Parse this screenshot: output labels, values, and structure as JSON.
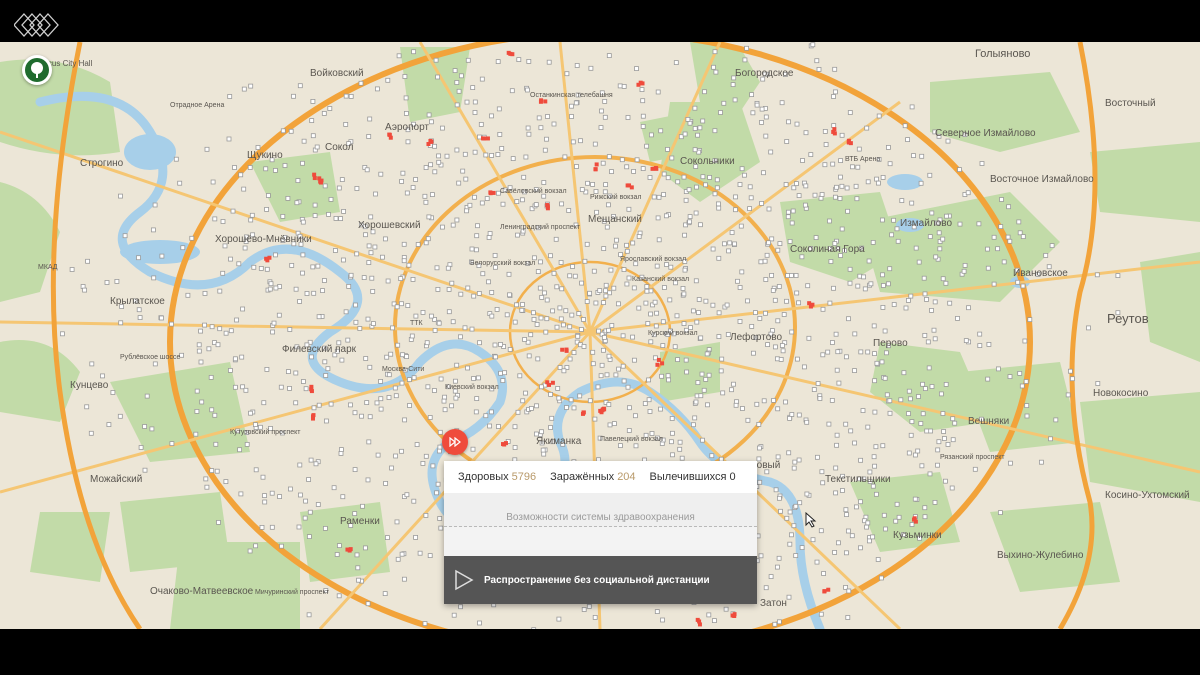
{
  "panel": {
    "stats": [
      {
        "label": "Здоровых",
        "value": "5796"
      },
      {
        "label": "Заражённых",
        "value": "204"
      },
      {
        "label": "Вылечившихся",
        "value": "0"
      }
    ],
    "health_system_label": "Возможности системы здравоохранения",
    "run_label": "Распространение без социальной дистанции"
  },
  "map": {
    "labels": [
      "Голыяново",
      "Crocus City Hall",
      "Войковский",
      "Останкинская телебашня",
      "Богородское",
      "Восточный",
      "Отрадное Арена",
      "Аэропорт",
      "Северное Измайлово",
      "Строгино",
      "Щукино",
      "Сокол",
      "Сокольники",
      "ВТБ Арена",
      "Савёловский вокзал",
      "Рижский вокзал",
      "Восточное Измайлово",
      "Мещанский",
      "Хорошевский",
      "Измайлово",
      "Хорошёво-Мнёвники",
      "Белорусский вокзал",
      "Ярославский вокзал",
      "Казанский вокзал",
      "Соколиная Гора",
      "Ивановское",
      "Крылатское",
      "Реутов",
      "Курский вокзал",
      "Лефортово",
      "Филевский парк",
      "Перово",
      "Кунцево",
      "Москва-Сити",
      "Киевский вокзал",
      "Новокосино",
      "Вешняки",
      "Якиманка",
      "Павелецкий вокзал",
      "Южнопортовый",
      "Текстильщики",
      "Можайский",
      "Косино-Ухтомский",
      "Раменки",
      "Кузьминки",
      "Выхино-Жулебино",
      "Очаково-Матвеевское",
      "Затон",
      "МКАД",
      "Рублёвское шоссе",
      "Кутузовский проспект",
      "Рязанский проспект",
      "Ленинградский проспект",
      "Мичуринский проспект",
      "ТТК"
    ]
  },
  "colors": {
    "infected": "#ef4b3c",
    "healthy_dot": "#9a9a9a",
    "panel_bar": "#555555",
    "park": "#bfd8a5",
    "water": "#a9cfe8",
    "mkad": "#f2a33a"
  },
  "icons": [
    "logo-diamonds-icon",
    "tree-icon",
    "fast-forward-icon",
    "play-icon",
    "mouse-cursor-icon"
  ]
}
